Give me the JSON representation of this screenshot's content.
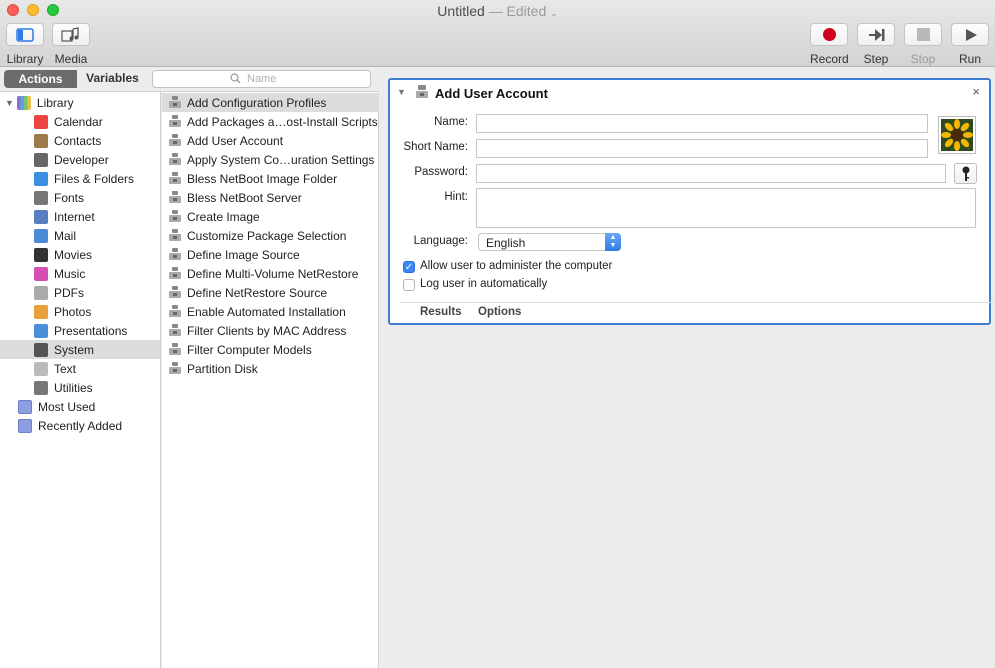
{
  "window": {
    "title": "Untitled",
    "edited": "— Edited",
    "chevron": "⌄"
  },
  "toolbar": {
    "library_label": "Library",
    "media_label": "Media",
    "record_label": "Record",
    "step_label": "Step",
    "stop_label": "Stop",
    "run_label": "Run"
  },
  "tabs": {
    "actions": "Actions",
    "variables": "Variables"
  },
  "search": {
    "placeholder": "Name"
  },
  "library": {
    "root": "Library",
    "items": [
      {
        "label": "Calendar",
        "icon": "calendar-icon",
        "color": "#e44"
      },
      {
        "label": "Contacts",
        "icon": "contacts-icon",
        "color": "#9c7a4a"
      },
      {
        "label": "Developer",
        "icon": "developer-icon",
        "color": "#666"
      },
      {
        "label": "Files & Folders",
        "icon": "finder-icon",
        "color": "#3c8fe0"
      },
      {
        "label": "Fonts",
        "icon": "fonts-icon",
        "color": "#777"
      },
      {
        "label": "Internet",
        "icon": "internet-icon",
        "color": "#5a7fc1"
      },
      {
        "label": "Mail",
        "icon": "mail-icon",
        "color": "#4a88d8"
      },
      {
        "label": "Movies",
        "icon": "movies-icon",
        "color": "#333"
      },
      {
        "label": "Music",
        "icon": "music-icon",
        "color": "#d64fb4"
      },
      {
        "label": "PDFs",
        "icon": "pdf-icon",
        "color": "#aaa"
      },
      {
        "label": "Photos",
        "icon": "photos-icon",
        "color": "#e9a03b"
      },
      {
        "label": "Presentations",
        "icon": "presentations-icon",
        "color": "#4a90d9"
      },
      {
        "label": "System",
        "icon": "system-icon",
        "color": "#555",
        "selected": true
      },
      {
        "label": "Text",
        "icon": "text-icon",
        "color": "#bbb"
      },
      {
        "label": "Utilities",
        "icon": "utilities-icon",
        "color": "#777"
      }
    ],
    "smart": [
      {
        "label": "Most Used",
        "icon": "smart-folder-icon"
      },
      {
        "label": "Recently Added",
        "icon": "smart-folder-icon"
      }
    ]
  },
  "actions": [
    "Add Configuration Profiles",
    "Add Packages a…ost-Install Scripts",
    "Add User Account",
    "Apply System Co…uration Settings",
    "Bless NetBoot Image Folder",
    "Bless NetBoot Server",
    "Create Image",
    "Customize Package Selection",
    "Define Image Source",
    "Define Multi-Volume NetRestore",
    "Define NetRestore Source",
    "Enable Automated Installation",
    "Filter Clients by MAC Address",
    "Filter Computer Models",
    "Partition Disk"
  ],
  "card": {
    "title": "Add User Account",
    "close": "×",
    "name_label": "Name:",
    "name_value": "",
    "short_name_label": "Short Name:",
    "short_name_value": "",
    "password_label": "Password:",
    "password_value": "",
    "hint_label": "Hint:",
    "hint_value": "",
    "language_label": "Language:",
    "language_value": "English",
    "admin_label": "Allow user to administer the computer",
    "admin_checked": true,
    "autologin_label": "Log user in automatically",
    "autologin_checked": false,
    "results_tab": "Results",
    "options_tab": "Options"
  },
  "colors": {
    "selection_border": "#3f7dd3",
    "record_red": "#d0021b",
    "checkbox_blue": "#3d87f5"
  }
}
